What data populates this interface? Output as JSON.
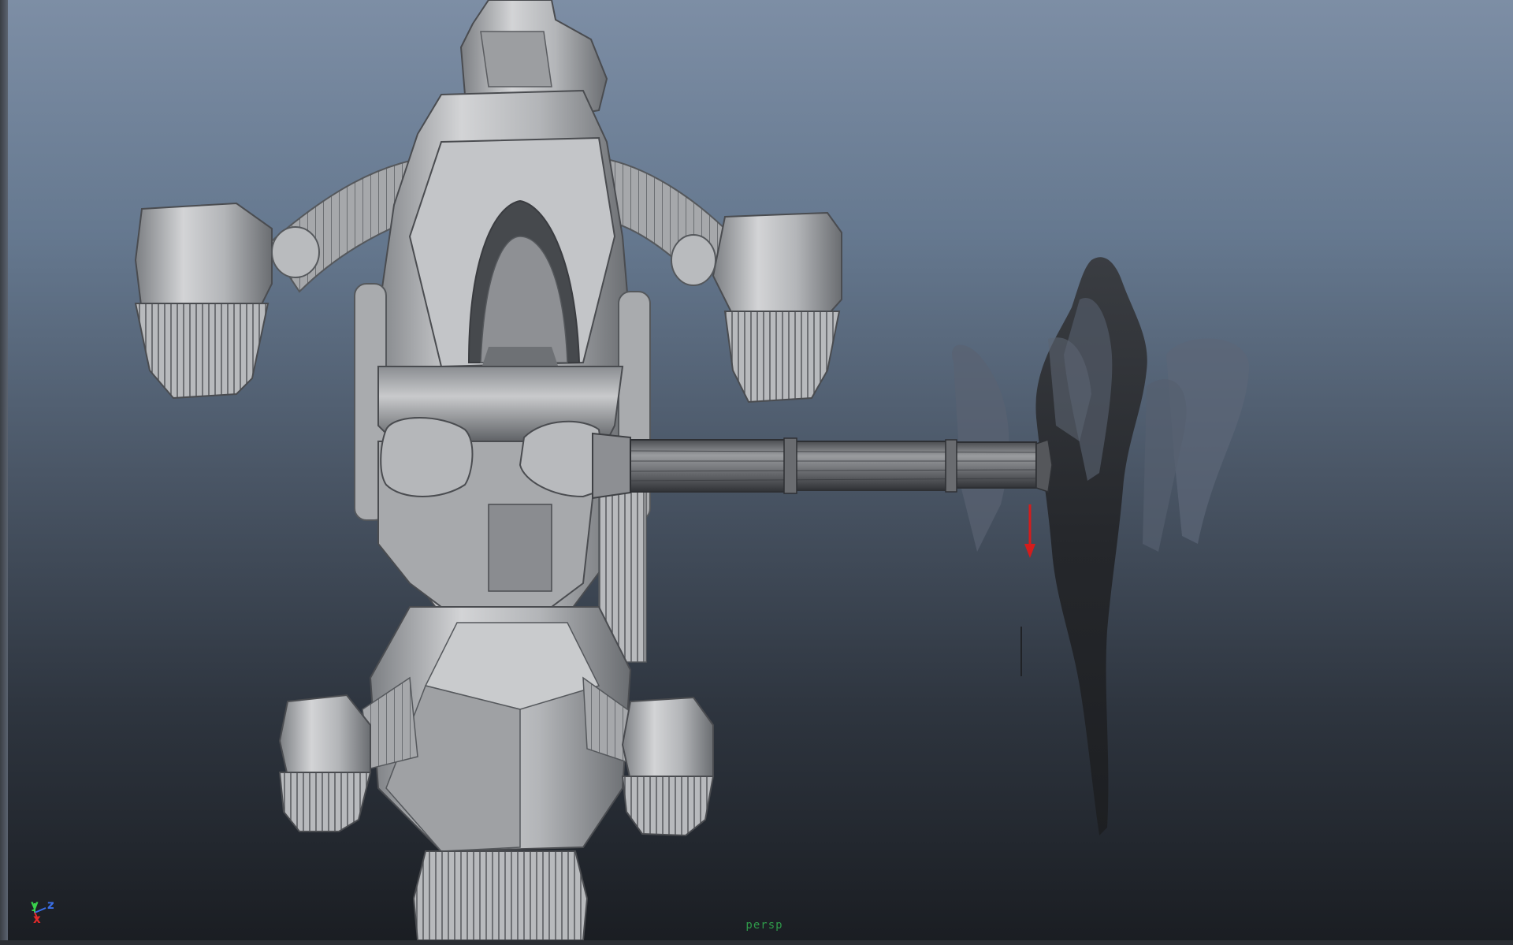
{
  "viewport": {
    "camera_label": "persp",
    "background_top": "#7d8ea5",
    "background_bottom": "#1a1d22"
  },
  "axis_gizmo": {
    "x_label": "x",
    "y_label": "y",
    "z_label": "z",
    "x_color": "#e02a2a",
    "y_color": "#39d24c",
    "z_color": "#3a6fe8"
  },
  "scene": {
    "objects": [
      "mech-model",
      "gatling-gun",
      "smoke-effect",
      "move-manipulator"
    ],
    "model_color": "#a9abad",
    "smoke_color": "#2a2c30",
    "manipulator_color": "#d51c1c"
  }
}
